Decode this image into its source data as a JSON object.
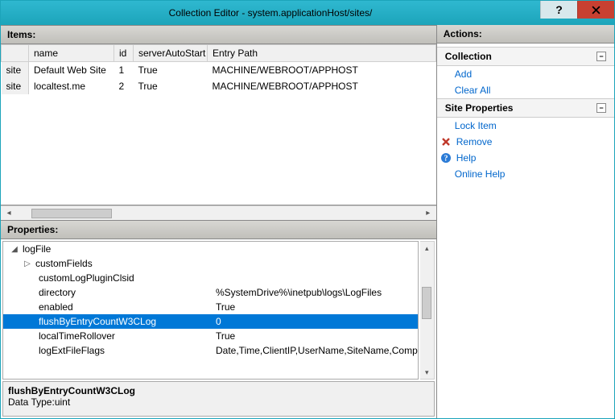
{
  "window": {
    "title": "Collection Editor - system.applicationHost/sites/"
  },
  "items": {
    "header": "Items:",
    "columns": {
      "c0": "",
      "c1": "name",
      "c2": "id",
      "c3": "serverAutoStart",
      "c4": "Entry Path"
    },
    "rows": [
      {
        "type": "site",
        "name": "Default Web Site",
        "id": "1",
        "auto": "True",
        "path": "MACHINE/WEBROOT/APPHOST"
      },
      {
        "type": "site",
        "name": "localtest.me",
        "id": "2",
        "auto": "True",
        "path": "MACHINE/WEBROOT/APPHOST"
      }
    ]
  },
  "properties": {
    "header": "Properties:",
    "root": "logFile",
    "children": [
      {
        "name": "customFields",
        "value": "",
        "expandable": true
      },
      {
        "name": "customLogPluginClsid",
        "value": ""
      },
      {
        "name": "directory",
        "value": "%SystemDrive%\\inetpub\\logs\\LogFiles"
      },
      {
        "name": "enabled",
        "value": "True"
      },
      {
        "name": "flushByEntryCountW3CLog",
        "value": "0",
        "selected": true
      },
      {
        "name": "localTimeRollover",
        "value": "True"
      },
      {
        "name": "logExtFileFlags",
        "value": "Date,Time,ClientIP,UserName,SiteName,Comp"
      }
    ],
    "description": {
      "name": "flushByEntryCountW3CLog",
      "type": "Data Type:uint"
    }
  },
  "actions": {
    "header": "Actions:",
    "groups": [
      {
        "title": "Collection",
        "links": [
          {
            "label": "Add"
          },
          {
            "label": "Clear All"
          }
        ]
      },
      {
        "title": "Site Properties",
        "links": [
          {
            "label": "Lock Item"
          },
          {
            "label": "Remove",
            "icon": "remove"
          },
          {
            "label": "Help",
            "icon": "help"
          },
          {
            "label": "Online Help"
          }
        ]
      }
    ]
  }
}
